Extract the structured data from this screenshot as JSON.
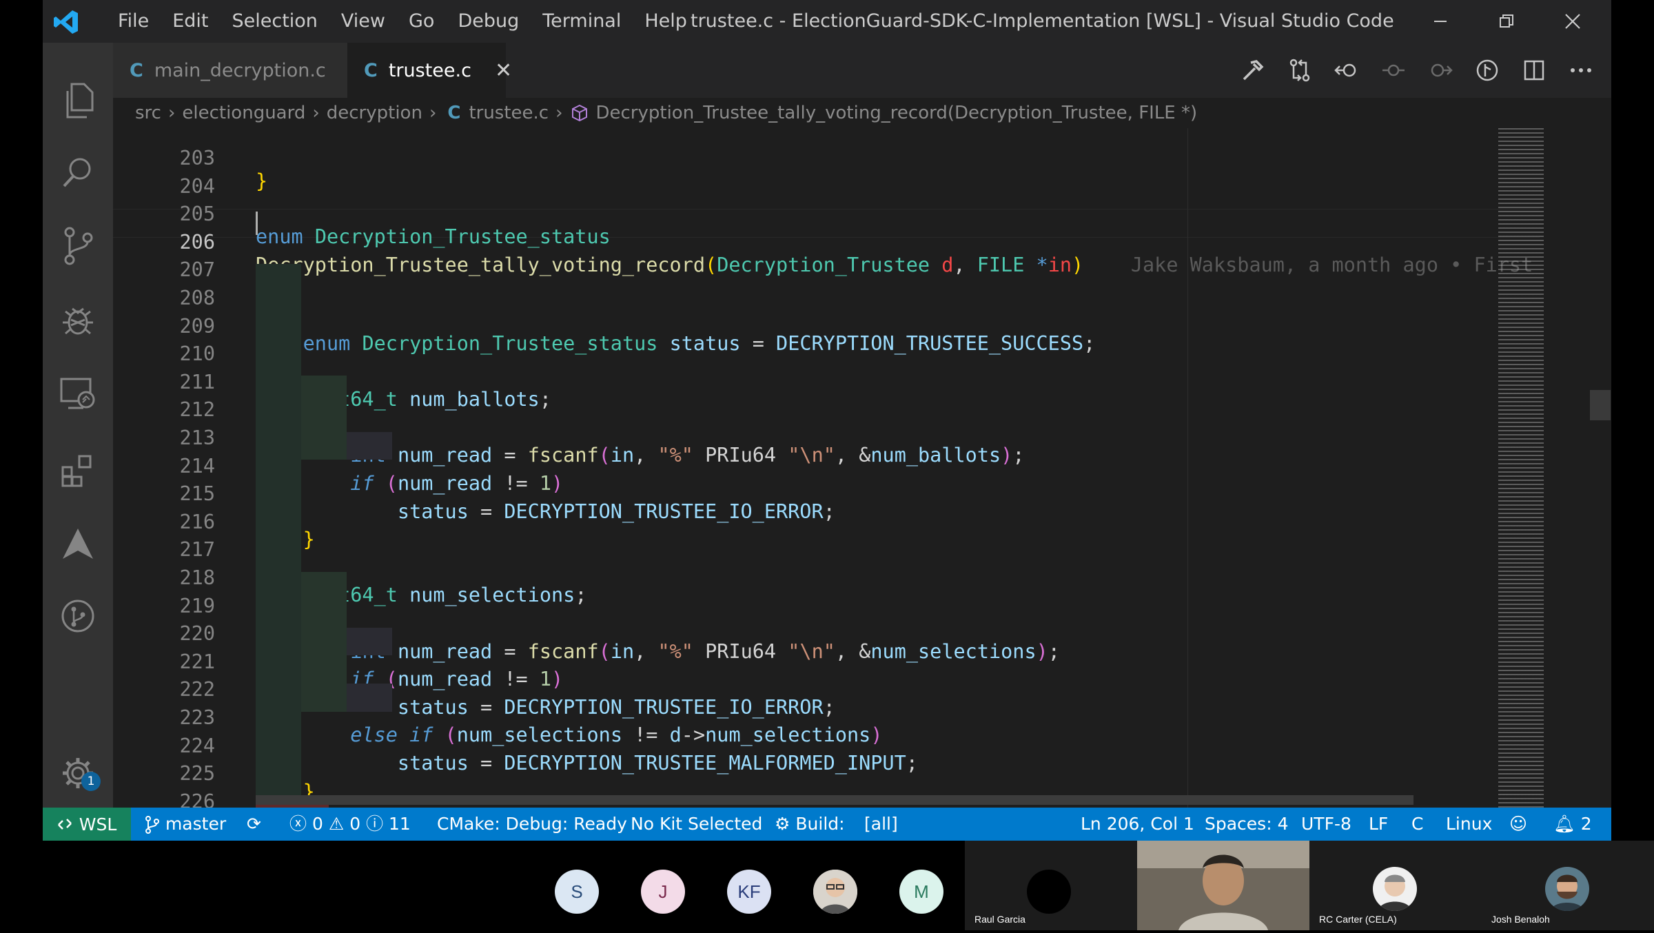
{
  "titlebar": {
    "menus": [
      "File",
      "Edit",
      "Selection",
      "View",
      "Go",
      "Debug",
      "Terminal",
      "Help"
    ],
    "window_title": "trustee.c - ElectionGuard-SDK-C-Implementation [WSL] - Visual Studio Code"
  },
  "tabs": [
    {
      "icon": "C",
      "label": "main_decryption.c"
    },
    {
      "icon": "C",
      "label": "trustee.c",
      "close": "✕"
    }
  ],
  "breadcrumb": {
    "parts": [
      "src",
      "electionguard",
      "decryption"
    ],
    "file_icon": "C",
    "file": "trustee.c",
    "symbol": "Decryption_Trustee_tally_voting_record(Decryption_Trustee, FILE *)"
  },
  "code": {
    "line_numbers": [
      "203",
      "204",
      "205",
      "206",
      "207",
      "208",
      "209",
      "210",
      "211",
      "212",
      "213",
      "214",
      "215",
      "216",
      "217",
      "218",
      "219",
      "220",
      "221",
      "222",
      "223",
      "224",
      "225",
      "226"
    ],
    "current_line": "206",
    "blame": "Jake Waksbaum, a month ago • First AP"
  },
  "status": {
    "remote": "WSL",
    "branch": "master",
    "errors": "0",
    "warnings": "0",
    "infos": "11",
    "cmake": "CMake: Debug: Ready",
    "kit": "No Kit Selected",
    "build": "Build:",
    "target": "[all]",
    "position": "Ln 206, Col 1",
    "spaces": "Spaces: 4",
    "encoding": "UTF-8",
    "eol": "LF",
    "language": "C",
    "os": "Linux",
    "notifications": "2"
  },
  "activity_badge": "1",
  "participants": {
    "avatars": [
      "S",
      "J",
      "KF",
      "M"
    ],
    "tiles": [
      "Raul Garcia",
      "RC Carter (CELA)",
      "Josh Benaloh"
    ]
  },
  "colors": {
    "statusbar": "#007acc",
    "remote": "#16825d",
    "editor_bg": "#1e1e1e"
  }
}
